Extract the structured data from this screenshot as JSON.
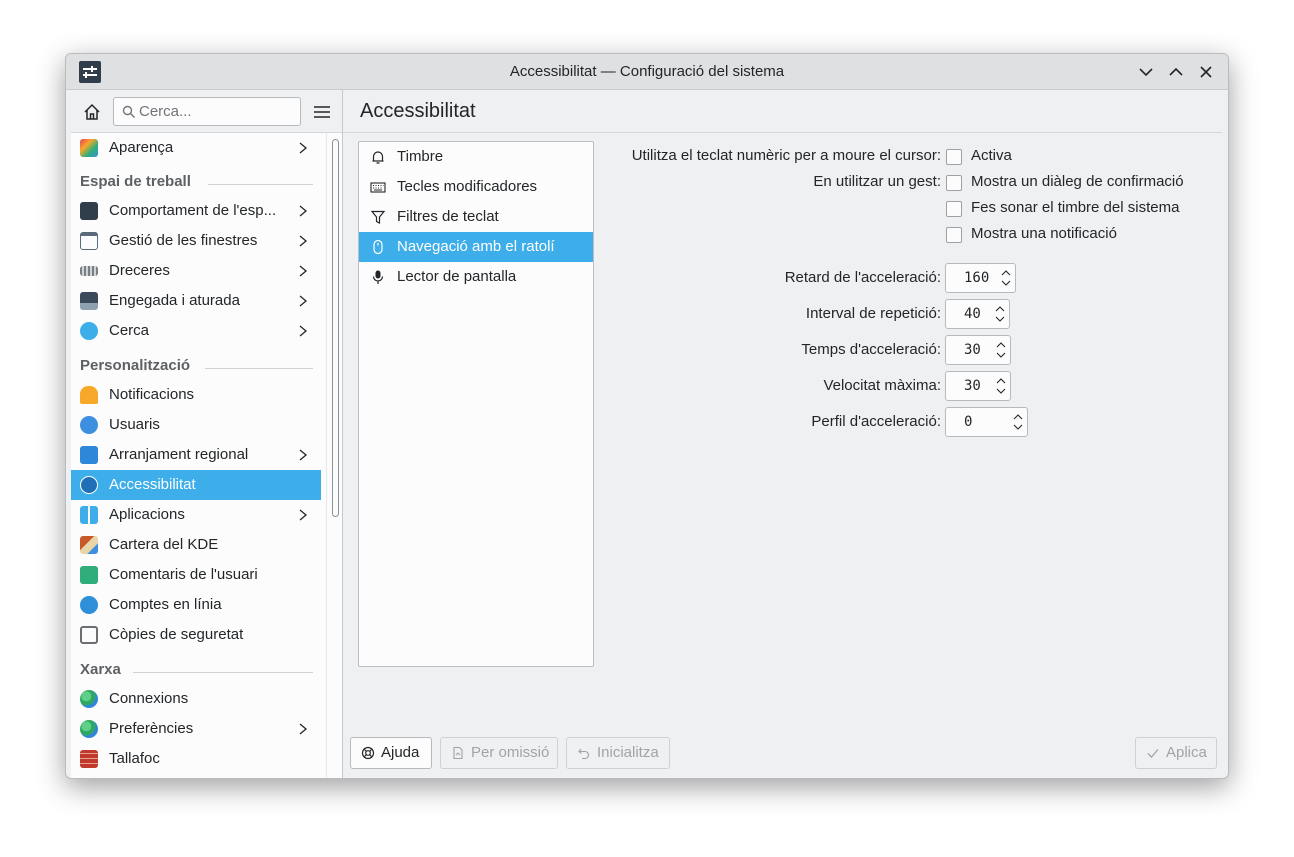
{
  "window": {
    "title": "Accessibilitat — Configuració del sistema"
  },
  "sidebar": {
    "search_placeholder": "Cerca...",
    "items": [
      {
        "label": "Aparença",
        "icon": "appearance-icon",
        "color": "#e83e5a",
        "arrow": true,
        "top": 0
      },
      {
        "label": "Comportament de l'esp...",
        "icon": "workspace-behavior-icon",
        "color": "#2f3e4a",
        "arrow": true
      },
      {
        "label": "Gestió de les finestres",
        "icon": "window-management-icon",
        "color": "#5b6a78",
        "arrow": true
      },
      {
        "label": "Dreceres",
        "icon": "keyboard-shortcuts-icon",
        "color": "#7a7f84",
        "arrow": true
      },
      {
        "label": "Engegada i aturada",
        "icon": "startup-shutdown-icon",
        "color": "#3a4a5a",
        "arrow": true
      },
      {
        "label": "Cerca",
        "icon": "search-settings-icon",
        "color": "#3daee9",
        "arrow": true
      },
      {
        "label": "Notificacions",
        "icon": "notifications-bell-icon",
        "color": "#f7a829",
        "arrow": false
      },
      {
        "label": "Usuaris",
        "icon": "users-icon",
        "color": "#3d8fe0",
        "arrow": false
      },
      {
        "label": "Arranjament regional",
        "icon": "regional-settings-icon",
        "color": "#2e87d8",
        "arrow": true
      },
      {
        "label": "Accessibilitat",
        "icon": "accessibility-icon",
        "color": "#1f6fb8",
        "arrow": false
      },
      {
        "label": "Aplicacions",
        "icon": "applications-icon",
        "color": "#3daee9",
        "arrow": true
      },
      {
        "label": "Cartera del KDE",
        "icon": "kde-wallet-icon",
        "color": "#c85a2a",
        "arrow": false
      },
      {
        "label": "Comentaris de l'usuari",
        "icon": "user-feedback-icon",
        "color": "#2fae7a",
        "arrow": false
      },
      {
        "label": "Comptes en línia",
        "icon": "online-accounts-icon",
        "color": "#2f8fd8",
        "arrow": false
      },
      {
        "label": "Còpies de seguretat",
        "icon": "backups-icon",
        "color": "#6b6f73",
        "arrow": false
      },
      {
        "label": "Connexions",
        "icon": "connections-globe-icon",
        "color": "#2fa864",
        "arrow": false
      },
      {
        "label": "Preferències",
        "icon": "network-preferences-icon",
        "color": "#2fa864",
        "arrow": true
      },
      {
        "label": "Tallafoc",
        "icon": "firewall-icon",
        "color": "#c0392b",
        "arrow": false
      }
    ],
    "sections": {
      "workspace": "Espai de treball",
      "personalization": "Personalització",
      "network": "Xarxa"
    }
  },
  "content": {
    "title": "Accessibilitat",
    "categories": [
      {
        "label": "Timbre",
        "icon": "bell-icon"
      },
      {
        "label": "Tecles modificadores",
        "icon": "keyboard-icon"
      },
      {
        "label": "Filtres de teclat",
        "icon": "filter-icon"
      },
      {
        "label": "Navegació amb el ratolí",
        "icon": "mouse-icon"
      },
      {
        "label": "Lector de pantalla",
        "icon": "microphone-icon"
      }
    ],
    "form": {
      "numpad_label": "Utilitza el teclat numèric per a moure el cursor:",
      "numpad_option": "Activa",
      "gesture_label": "En utilitzar un gest:",
      "gesture_options": [
        "Mostra un diàleg de confirmació",
        "Fes sonar el timbre del sistema",
        "Mostra una notificació"
      ],
      "acceleration_delay_label": "Retard de l'acceleració:",
      "acceleration_delay": "160",
      "repeat_interval_label": "Interval de repetició:",
      "repeat_interval": "40",
      "acceleration_time_label": "Temps d'acceleració:",
      "acceleration_time": "30",
      "max_speed_label": "Velocitat màxima:",
      "max_speed": "30",
      "acceleration_profile_label": "Perfil d'acceleració:",
      "acceleration_profile": "0"
    },
    "buttons": {
      "help": "Ajuda",
      "defaults": "Per omissió",
      "reset": "Inicialitza",
      "apply": "Aplica"
    }
  },
  "colors": {
    "accent": "#3daee9",
    "window_bg": "#eff0f1",
    "view_bg": "#fcfcfc"
  }
}
